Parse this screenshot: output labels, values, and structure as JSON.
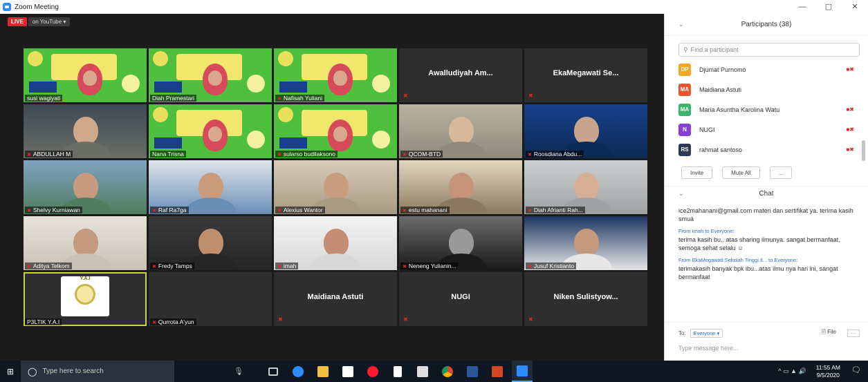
{
  "window": {
    "title": "Zoom Meeting",
    "controls": [
      "—",
      "▢",
      "✕"
    ]
  },
  "stream": {
    "live_label": "LIVE",
    "target_label": "on YouTube ▾"
  },
  "tiles": [
    {
      "name": "susi wagiyati",
      "kind": "slide"
    },
    {
      "name": "Diah Pramestari",
      "kind": "slide"
    },
    {
      "name": "Nafisah Yuliani",
      "kind": "slide"
    },
    {
      "name": "Awalludiyah Am...",
      "kind": "text"
    },
    {
      "name": "EkaMegawati Se...",
      "kind": "text"
    },
    {
      "name": "ABDULLAH M",
      "kind": "video"
    },
    {
      "name": "Nana Trisna",
      "kind": "slide"
    },
    {
      "name": "sularso budilaksono",
      "kind": "slide"
    },
    {
      "name": "QCOM-BTD",
      "kind": "video"
    },
    {
      "name": "Roosdiana Abdu...",
      "kind": "video"
    },
    {
      "name": "Shelvy Kurniawan",
      "kind": "video"
    },
    {
      "name": "Raf Ra7ga",
      "kind": "video"
    },
    {
      "name": "Alexius Wantor",
      "kind": "video"
    },
    {
      "name": "estu mahanani",
      "kind": "video"
    },
    {
      "name": "Diah Afrianti Rah...",
      "kind": "video"
    },
    {
      "name": "Aditya Telkom",
      "kind": "video"
    },
    {
      "name": "Fredy Tamps",
      "kind": "video"
    },
    {
      "name": "imah",
      "kind": "video"
    },
    {
      "name": "Neneng Yulianin...",
      "kind": "video"
    },
    {
      "name": "Jusuf Kristianto",
      "kind": "video"
    },
    {
      "name": "P3LTIK Y.A.I",
      "kind": "logo"
    },
    {
      "name": "Qurrota A'yun",
      "kind": "blank"
    },
    {
      "name": "Maidiana Astuti",
      "kind": "text"
    },
    {
      "name": "NUGI",
      "kind": "text"
    },
    {
      "name": "Niken Sulistyow...",
      "kind": "text"
    }
  ],
  "logo_text": "Y.A.I",
  "participants": {
    "title": "Participants (38)",
    "search_placeholder": "Find a participant",
    "list": [
      {
        "initials": "DP",
        "name": "Djumat Purnomo",
        "color": "#f5a623",
        "video_off": true
      },
      {
        "initials": "MA",
        "name": "Maidiana Astuti",
        "color": "#e8552d",
        "video_off": false
      },
      {
        "initials": "MA",
        "name": "Maria Asuntha Karolina Watu",
        "color": "#3bb56b",
        "video_off": true
      },
      {
        "initials": "N",
        "name": "NUGI",
        "color": "#8b3fd9",
        "video_off": true
      },
      {
        "initials": "RS",
        "name": "rahmat santoso",
        "color": "#2b3a55",
        "video_off": true
      }
    ],
    "invite_label": "Invite",
    "mute_all_label": "Mute All",
    "more_label": "..."
  },
  "chat": {
    "title": "Chat",
    "messages": [
      {
        "from": "",
        "to": "",
        "text": "ice2mahanani@gmail.com materi dan sertifikat ya. terima kasih smua"
      },
      {
        "from": "From Imah to Everyone:",
        "text": "terima kasih bu.. atas sharing ilmunya. sangat bermanfaat, semoga sehat selalu ☺"
      },
      {
        "from": "From EkaMegawati Sekolah Tinggi Il...  to Everyone:",
        "text": "terimakasih banyak bpk ibu...atas ilmu nya hari ini, sangat bermanfaat"
      }
    ],
    "to_label": "To:",
    "to_value": "Everyone ▾",
    "file_label": "File",
    "placeholder": "Type message here..."
  },
  "taskbar": {
    "search_placeholder": "Type here to search",
    "time": "11:55 AM",
    "date": "9/5/2020"
  }
}
